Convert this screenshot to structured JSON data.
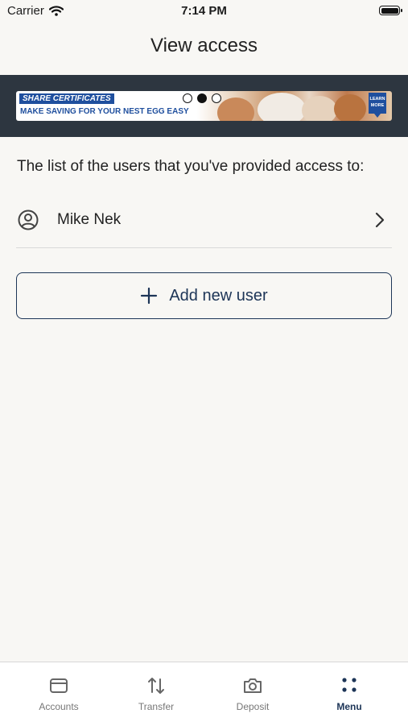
{
  "status_bar": {
    "carrier": "Carrier",
    "time": "7:14 PM"
  },
  "header": {
    "title": "View access"
  },
  "banner": {
    "headline": "SHARE CERTIFICATES",
    "subline": "MAKE SAVING FOR YOUR NEST EGG EASY",
    "cta": "LEARN MORE",
    "slides": 3,
    "active_slide": 2
  },
  "content": {
    "intro": "The list of the users that you've provided access to:",
    "users": [
      {
        "name": "Mike Nek"
      }
    ],
    "add_button": "Add new user"
  },
  "tabs": [
    {
      "label": "Accounts",
      "icon": "wallet-icon",
      "active": false
    },
    {
      "label": "Transfer",
      "icon": "transfer-arrows-icon",
      "active": false
    },
    {
      "label": "Deposit",
      "icon": "camera-icon",
      "active": false
    },
    {
      "label": "Menu",
      "icon": "menu-dots-icon",
      "active": true
    }
  ],
  "colors": {
    "accent": "#1d3557",
    "banner_blue": "#1f4f9e",
    "banner_bg": "#2d3640"
  }
}
